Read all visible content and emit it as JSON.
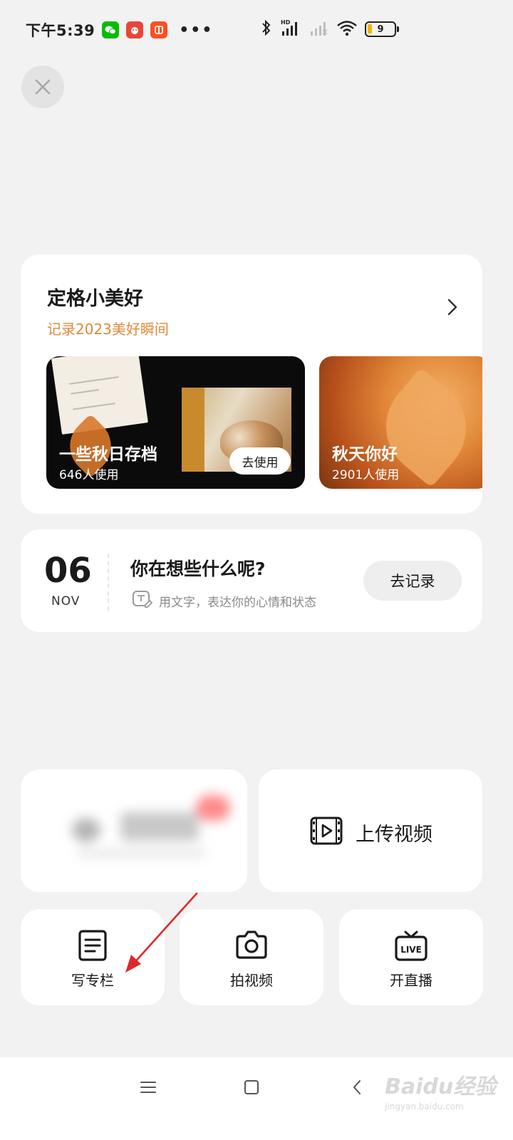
{
  "status_bar": {
    "time": "下午5:39",
    "more": "•••",
    "battery": "9",
    "apps": [
      {
        "name": "wechat-icon",
        "color": "#09bb07"
      },
      {
        "name": "app-red-icon",
        "color": "#e8463a"
      },
      {
        "name": "taobao-icon",
        "color": "#ff4e1f"
      }
    ]
  },
  "moment_card": {
    "title": "定格小美好",
    "subtitle": "记录2023美好瞬间",
    "templates": [
      {
        "name": "一些秋日存档",
        "count": "646人使用",
        "button": "去使用"
      },
      {
        "name": "秋天你好",
        "count": "2901人使用"
      }
    ]
  },
  "date_card": {
    "day": "06",
    "month": "NOV",
    "prompt": "你在想些什么呢?",
    "hint": "用文字，表达你的心情和状态",
    "button": "去记录"
  },
  "tiles": {
    "upload_video": "上传视频",
    "write_column": "写专栏",
    "shoot_video": "拍视频",
    "go_live": "开直播"
  },
  "watermark": {
    "main": "Baidu经验",
    "sub": "jingyan.baidu.com"
  },
  "colors": {
    "accent_orange": "#e08a3a",
    "annotation_red": "#e0282a",
    "background": "#f2f2f2"
  }
}
